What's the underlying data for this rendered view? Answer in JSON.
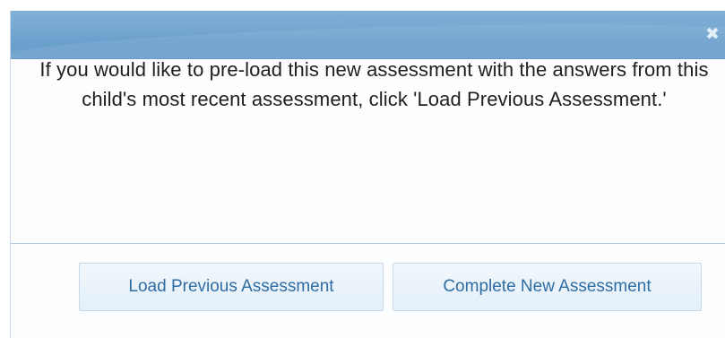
{
  "dialog": {
    "title": "",
    "close_glyph": "✖",
    "message": "If you would like to pre-load this new assessment with the answers from this child's most recent assessment, click 'Load Previous Assessment.'",
    "buttons": {
      "load_previous": "Load Previous Assessment",
      "complete_new": "Complete New Assessment"
    },
    "colors": {
      "titlebar": "#6ca0cd",
      "button_text": "#2e6da4",
      "button_bg": "#e4eff8",
      "divider": "#aac8e3"
    },
    "icons": {
      "close": "close-icon"
    }
  }
}
